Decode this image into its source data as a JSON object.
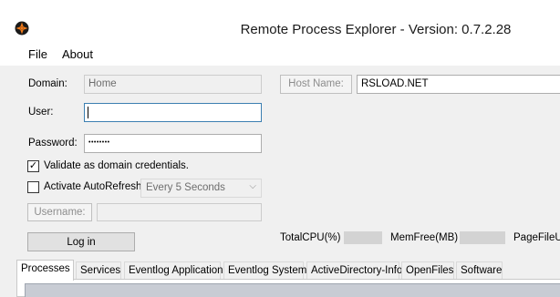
{
  "window": {
    "title": "Remote Process Explorer - Version: 0.7.2.28",
    "icon": "app-logo-icon"
  },
  "menu": {
    "file": "File",
    "about": "About"
  },
  "form": {
    "domain_label": "Domain:",
    "domain_value": "Home",
    "host_name_button": "Host Name:",
    "host_name_value": "RSLOAD.NET",
    "user_label": "User:",
    "user_value": "",
    "password_label": "Password:",
    "password_value": "••••••••",
    "validate_label": "Validate as domain credentials.",
    "validate_checked": true,
    "autorefresh_label": "Activate AutoRefresh",
    "autorefresh_checked": false,
    "refresh_interval": "Every 5 Seconds",
    "username_button": "Username:",
    "login_button": "Log in"
  },
  "stats": {
    "cpu_label": "TotalCPU(%)",
    "mem_label": "MemFree(MB)",
    "pagefile_label": "PageFileUs"
  },
  "tabs": [
    {
      "label": "Processes",
      "active": true
    },
    {
      "label": "Services",
      "active": false
    },
    {
      "label": "Eventlog Application",
      "active": false
    },
    {
      "label": "Eventlog System",
      "active": false
    },
    {
      "label": "ActiveDirectory-Info",
      "active": false
    },
    {
      "label": "OpenFiles",
      "active": false
    },
    {
      "label": "Software",
      "active": false
    }
  ],
  "colors": {
    "accent_focus": "#3c7fb1",
    "window_bg": "#f0f0f0",
    "icon_orange": "#f07a1a"
  }
}
